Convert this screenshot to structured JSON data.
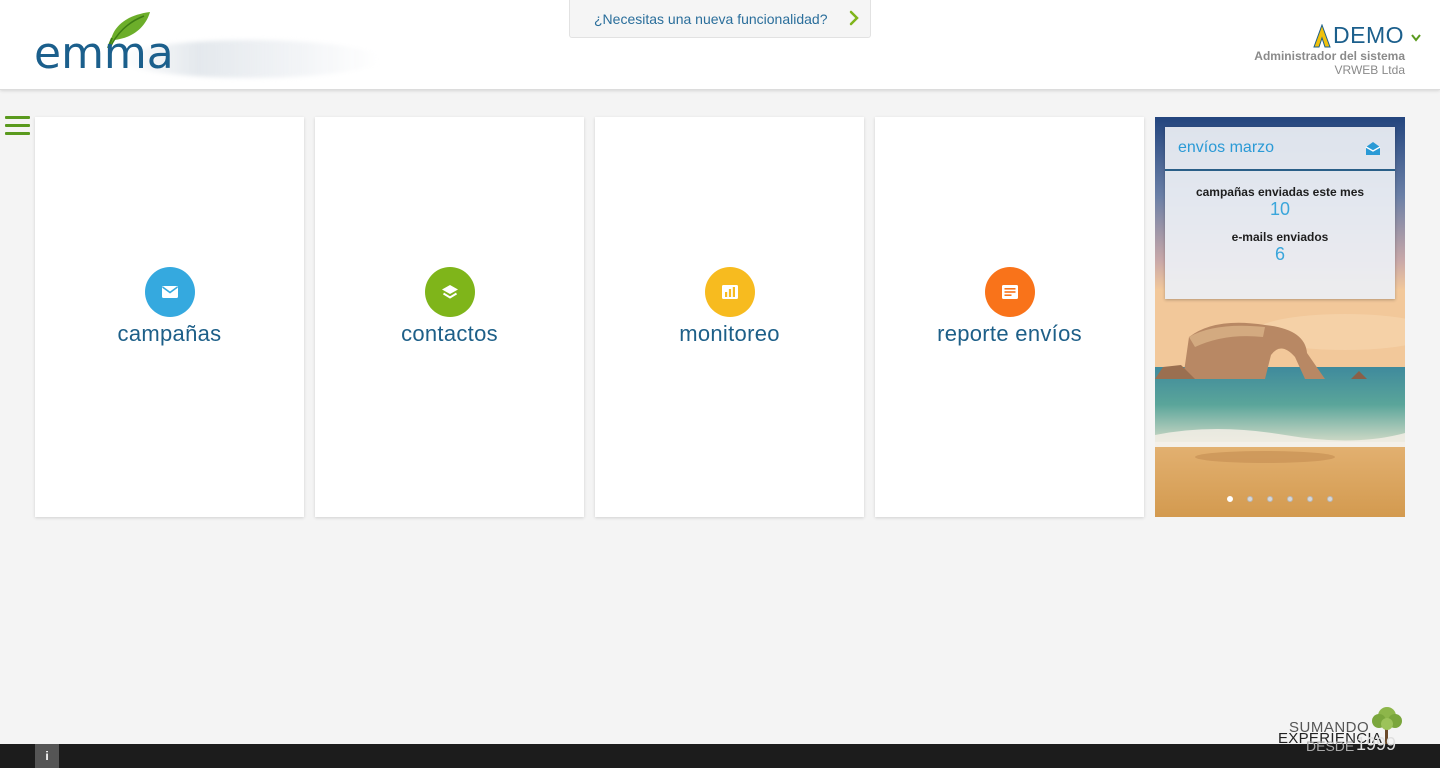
{
  "header": {
    "logo_text": "emma",
    "feature_request_label": "¿Necesitas una nueva funcionalidad?",
    "user": {
      "name": "DEMO",
      "role": "Administrador del sistema",
      "company": "VRWEB Ltda"
    }
  },
  "tiles": [
    {
      "label": "campañas",
      "icon": "mail-icon",
      "color": "#35a9df"
    },
    {
      "label": "contactos",
      "icon": "layers-icon",
      "color": "#7fb51a"
    },
    {
      "label": "monitoreo",
      "icon": "bar-chart-icon",
      "color": "#f7bb1f"
    },
    {
      "label": "reporte envíos",
      "icon": "document-lines-icon",
      "color": "#f9731a"
    }
  ],
  "widget": {
    "title": "envíos marzo",
    "stats": [
      {
        "label": "campañas enviadas este mes",
        "value": "10"
      },
      {
        "label": "e-mails enviados",
        "value": "6"
      }
    ],
    "slide_count": 6,
    "active_slide": 1
  },
  "footer": {
    "info_label": "i",
    "stamp": {
      "line1": "SUMANDO",
      "line2": "EXPERIENCIA",
      "line3_prefix": "DESDE",
      "line3_year": "1999"
    }
  },
  "colors": {
    "brand_blue": "#1b5f8c",
    "accent_green": "#5a9a1e",
    "footer_bg": "#1c1c1c"
  }
}
